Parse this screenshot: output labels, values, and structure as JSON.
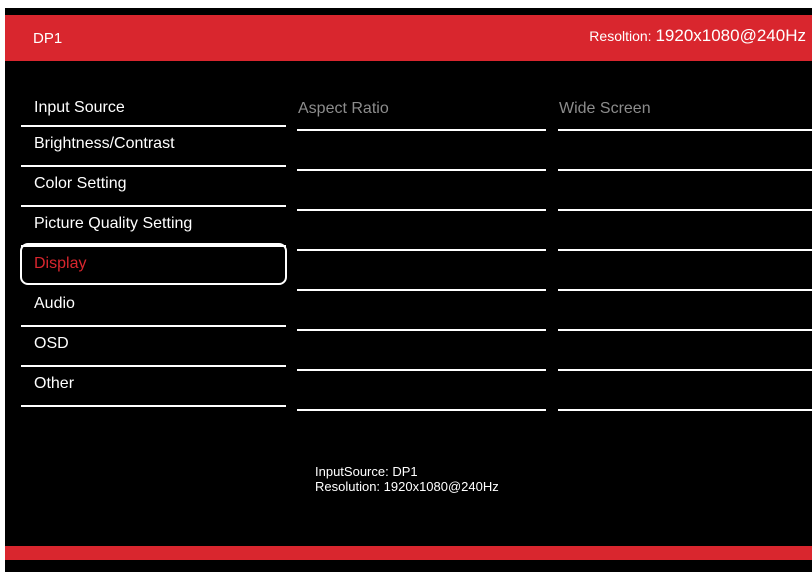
{
  "header": {
    "source": "DP1",
    "resolution_label": "Resoltion: ",
    "resolution_value": "1920x1080@240Hz"
  },
  "menu": {
    "items": [
      {
        "label": "Input Source"
      },
      {
        "label": "Brightness/Contrast"
      },
      {
        "label": "Color Setting"
      },
      {
        "label": "Picture Quality Setting"
      },
      {
        "label": "Display"
      },
      {
        "label": "Audio"
      },
      {
        "label": "OSD"
      },
      {
        "label": "Other"
      }
    ],
    "selected": "Display"
  },
  "submenu": {
    "items": [
      {
        "label": "Aspect Ratio"
      }
    ]
  },
  "options": {
    "items": [
      {
        "label": "Wide Screen"
      }
    ]
  },
  "info": {
    "input_source": "InputSource: DP1",
    "resolution": "Resolution: 1920x1080@240Hz"
  },
  "colors": {
    "accent": "#d9262e",
    "background": "#000000",
    "text": "#ffffff",
    "muted": "#8c8c8c"
  }
}
